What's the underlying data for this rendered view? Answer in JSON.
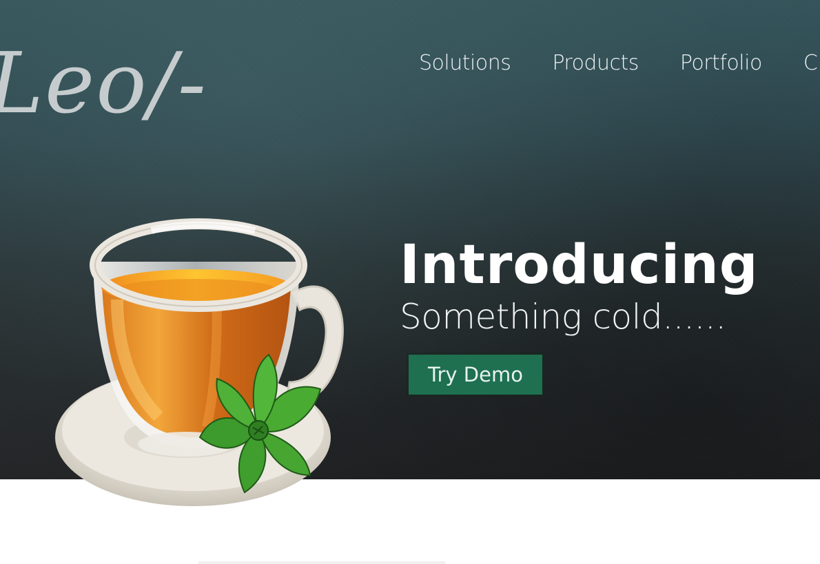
{
  "logo": {
    "text": "Leo/-"
  },
  "nav": {
    "items": [
      {
        "label": "Solutions"
      },
      {
        "label": "Products"
      },
      {
        "label": "Portfolio"
      },
      {
        "label": "C"
      }
    ]
  },
  "hero": {
    "title": "Introducing",
    "subtitle": "Something cold......",
    "cta_label": "Try Demo",
    "image_name": "teacup-with-mint-illustration"
  },
  "colors": {
    "hero_top": "#34545b",
    "hero_bottom": "#232426",
    "cta_background": "#1f7050",
    "text": "#ffffff"
  }
}
